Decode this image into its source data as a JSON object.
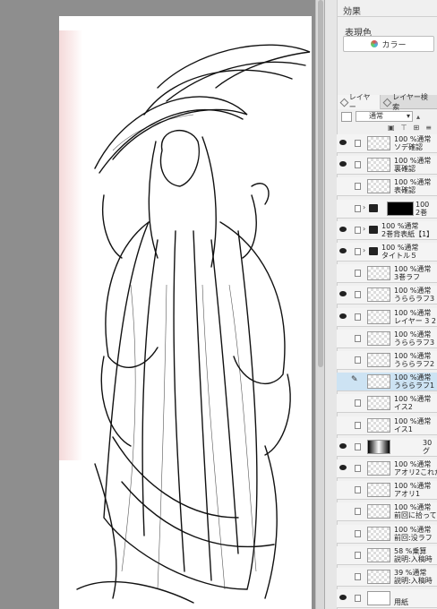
{
  "panel": {
    "effect_title": "効果",
    "color_label": "表現色",
    "color_button": "カラー",
    "tabs": [
      "レイヤー",
      "レイヤー検索"
    ],
    "blend_mode": "通常"
  },
  "layers": [
    {
      "line1": "100 %通常",
      "line2": "ソデ確認",
      "visible": true,
      "kind": "raster"
    },
    {
      "line1": "100 %通常",
      "line2": "裏確認",
      "visible": true,
      "kind": "raster"
    },
    {
      "line1": "100 %通常",
      "line2": "表確認",
      "visible": false,
      "kind": "raster"
    },
    {
      "line1": "100",
      "line2": "2巻",
      "visible": false,
      "kind": "group-dark"
    },
    {
      "line1": "100 %通常",
      "line2": "2巻背表紙【1】",
      "visible": true,
      "kind": "group"
    },
    {
      "line1": "100 %通常",
      "line2": "タイトル５",
      "visible": true,
      "kind": "group"
    },
    {
      "line1": "100 %通常",
      "line2": "3巻ラフ",
      "visible": false,
      "kind": "raster"
    },
    {
      "line1": "100 %通常",
      "line2": "うららラフ3 2",
      "visible": true,
      "kind": "raster"
    },
    {
      "line1": "100 %通常",
      "line2": "レイヤー 3 2",
      "visible": true,
      "kind": "raster"
    },
    {
      "line1": "100 %通常",
      "line2": "うららラフ3",
      "visible": false,
      "kind": "raster"
    },
    {
      "line1": "100 %通常",
      "line2": "うららラフ2",
      "visible": false,
      "kind": "raster"
    },
    {
      "line1": "100 %通常",
      "line2": "うららラフ1",
      "visible": false,
      "kind": "raster",
      "selected": true
    },
    {
      "line1": "100 %通常",
      "line2": "イス2",
      "visible": false,
      "kind": "raster"
    },
    {
      "line1": "100 %通常",
      "line2": "イス1",
      "visible": false,
      "kind": "raster"
    },
    {
      "line1": "30",
      "line2": "グ",
      "visible": true,
      "kind": "gradient"
    },
    {
      "line1": "100 %通常",
      "line2": "アオリ2これかな",
      "visible": true,
      "kind": "raster"
    },
    {
      "line1": "100 %通常",
      "line2": "アオリ1",
      "visible": false,
      "kind": "raster"
    },
    {
      "line1": "100 %通常",
      "line2": "前回に拾ってる",
      "visible": false,
      "kind": "raster"
    },
    {
      "line1": "100 %通常",
      "line2": "前回:没ラフ",
      "visible": false,
      "kind": "raster"
    },
    {
      "line1": "58 %乗算",
      "line2": "説明:入稿時",
      "visible": false,
      "kind": "raster"
    },
    {
      "line1": "39 %通常",
      "line2": "説明:入稿時",
      "visible": false,
      "kind": "raster"
    },
    {
      "line1": "",
      "line2": "用紙",
      "visible": true,
      "kind": "paper"
    }
  ]
}
